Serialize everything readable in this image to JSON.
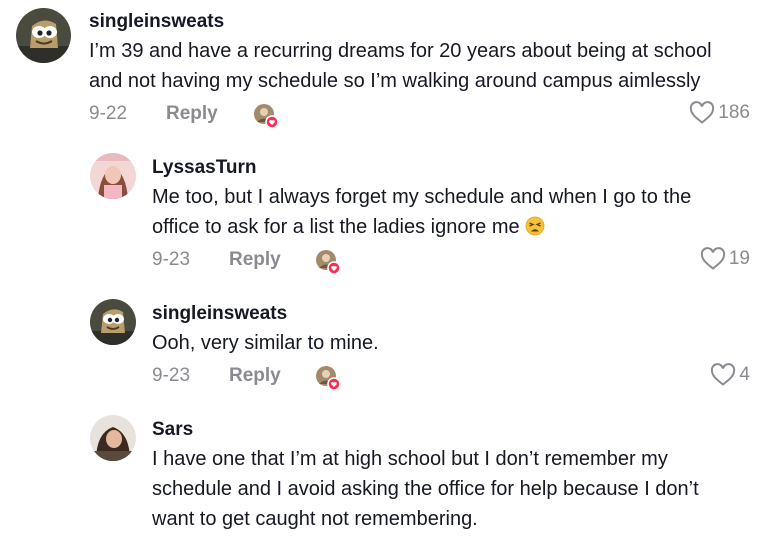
{
  "comments": [
    {
      "username": "singleinsweats",
      "text_lines": [
        "I’m 39 and have a recurring dreams for 20 years about being at school",
        "and not having my schedule so I’m walking around campus aimlessly"
      ],
      "date": "9-22",
      "reply_label": "Reply",
      "likes": "186"
    },
    {
      "username": "LyssasTurn",
      "text_lines": [
        "Me too, but I always forget my schedule and when I go to the",
        "office to ask for a list the ladies ignore me"
      ],
      "date": "9-23",
      "reply_label": "Reply",
      "likes": "19"
    },
    {
      "username": "singleinsweats",
      "text_lines": [
        "Ooh, very similar to mine."
      ],
      "date": "9-23",
      "reply_label": "Reply",
      "likes": "4"
    },
    {
      "username": "Sars",
      "text_lines": [
        "I have one that I’m at high school but I don’t remember my",
        "schedule and I avoid asking the office for help because I don’t",
        "want to get caught not remembering."
      ]
    }
  ],
  "colors": {
    "text": "#161823",
    "secondary": "#8a8b91",
    "creator_badge": "#fe2c55"
  },
  "icons": {
    "like": "heart-outline-icon",
    "emoji": "tired-face-emoji"
  }
}
